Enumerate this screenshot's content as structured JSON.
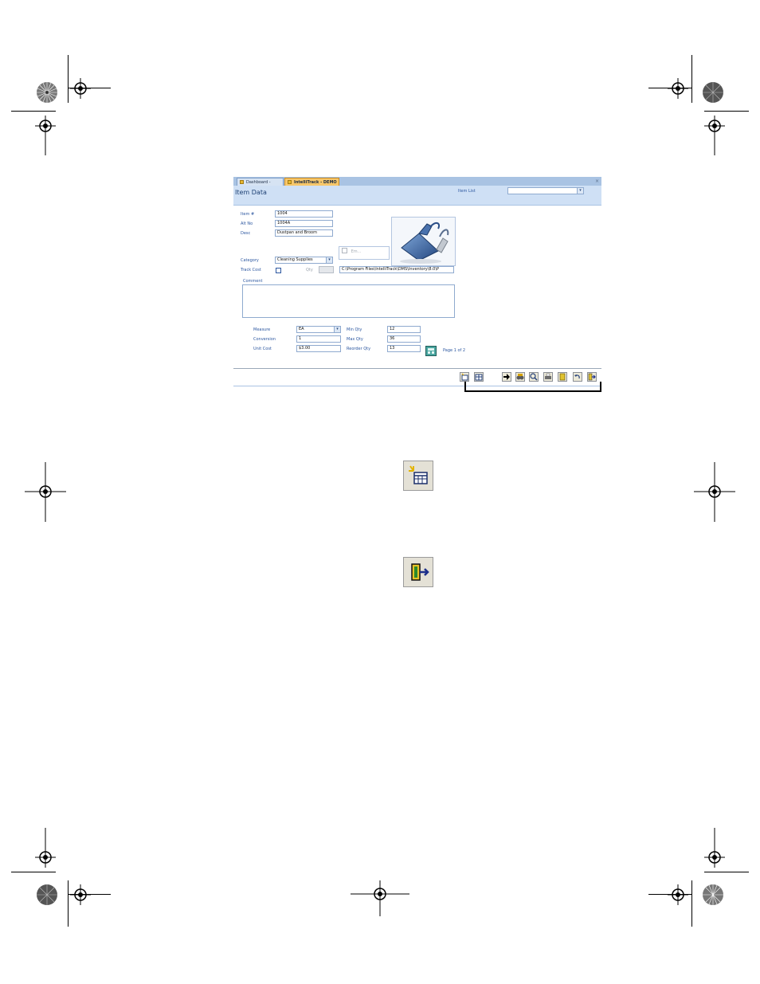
{
  "tabs": [
    {
      "label": "Dashboard - DEMO",
      "active": false
    },
    {
      "label": "IntelliTrack - DEMO",
      "active": true
    }
  ],
  "tab_close": "×",
  "page_title": "Item Data",
  "item_list": {
    "label": "Item List",
    "value": ""
  },
  "form": {
    "item_no_label": "Item #",
    "item_no": "1004",
    "alt_no_label": "Alt No",
    "alt_no": "1004A",
    "desc_label": "Desc",
    "desc": "Dustpan and Broom",
    "category_label": "Category",
    "category": "Cleaning Supplies",
    "track_cost_label": "Track Cost",
    "qty_label": "Qty",
    "embedded_label": "Em...",
    "image_path": "C:\\Program Files\\IntelliTrack\\DMS\\Inventory\\8.0\\P",
    "comment_label": "Comment",
    "comment": "",
    "measure_label": "Measure",
    "measure": "EA",
    "conversion_label": "Conversion",
    "conversion": "1",
    "unit_cost_label": "Unit Cost",
    "unit_cost": "$3.00",
    "min_qty_label": "Min Qty",
    "min_qty": "12",
    "max_qty_label": "Max Qty",
    "max_qty": "36",
    "reorder_qty_label": "Reorder Qty",
    "reorder_qty": "13"
  },
  "pager": {
    "text": "Page 1 of 2"
  },
  "toolbar_icons": [
    "new-record-icon",
    "calendar-grid-icon",
    "arrow-right-icon",
    "binoculars-icon",
    "search-icon",
    "print-icon",
    "report-icon",
    "undo-icon",
    "exit-door-icon"
  ],
  "colors": {
    "tab_active": "#f7c76a",
    "header": "#cfe0f5",
    "label": "#2c57a0"
  }
}
